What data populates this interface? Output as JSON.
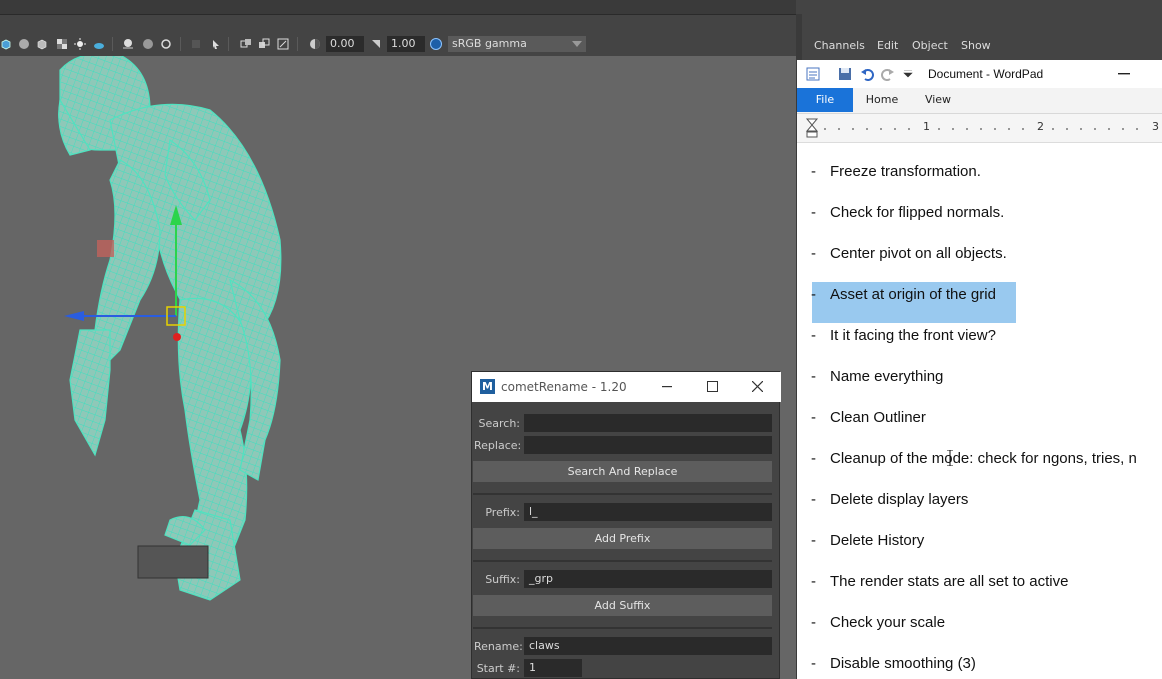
{
  "maya_toolbar": {
    "exposure_value": "0.00",
    "gamma_value": "1.00",
    "color_space": "sRGB gamma"
  },
  "channel_box": {
    "menus": [
      "Channels",
      "Edit",
      "Object",
      "Show"
    ]
  },
  "wordpad": {
    "title": "Document - WordPad",
    "tabs": [
      "File",
      "Home",
      "View"
    ],
    "ruler_marks": [
      "1",
      "2",
      "3"
    ],
    "dash": "-",
    "lines": [
      "Freeze transformation.",
      "Check for flipped normals.",
      "Center pivot on all objects.",
      "Asset at origin of the grid",
      "It it facing the front view?",
      "Name everything",
      "Clean Outliner",
      "Cleanup of the mode: check for ngons, tries, n",
      "Delete display layers",
      "Delete History",
      "The render stats are all set to active",
      "Check your scale",
      "Disable smoothing (3)"
    ]
  },
  "comet": {
    "title": "cometRename - 1.20",
    "search_label": "Search:",
    "search_value": "",
    "replace_label": "Replace:",
    "replace_value": "",
    "search_replace_btn": "Search And Replace",
    "prefix_label": "Prefix:",
    "prefix_value": "l_",
    "add_prefix_btn": "Add Prefix",
    "suffix_label": "Suffix:",
    "suffix_value": "_grp",
    "add_suffix_btn": "Add Suffix",
    "rename_label": "Rename:",
    "rename_value": "claws",
    "start_label": "Start #:",
    "start_value": "1"
  },
  "colors": {
    "mesh": "#4fe3c0",
    "selection_highlight": "#99c9ef",
    "file_tab": "#1a73d9"
  }
}
